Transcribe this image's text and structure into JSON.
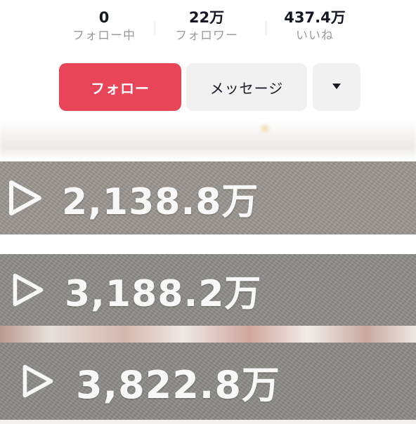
{
  "stats": {
    "following": {
      "value": "0",
      "label": "フォロー中"
    },
    "followers": {
      "value": "22万",
      "label": "フォロワー"
    },
    "likes": {
      "value": "437.4万",
      "label": "いいね"
    }
  },
  "actions": {
    "follow_label": "フォロー",
    "message_label": "メッセージ",
    "more_icon": "caret-down-icon",
    "follow_color": "#e94559"
  },
  "videos": [
    {
      "icon": "play-icon",
      "views": "2,138.8万"
    },
    {
      "icon": "play-icon",
      "views": "3,188.2万"
    },
    {
      "icon": "play-icon",
      "views": "3,822.8万"
    }
  ]
}
